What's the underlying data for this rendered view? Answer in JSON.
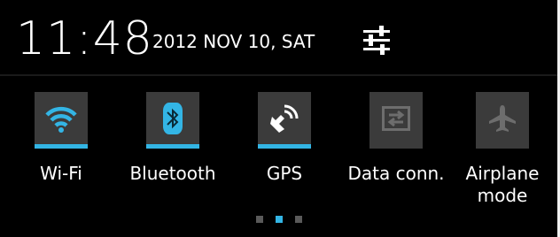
{
  "status": {
    "time": "11:48",
    "date": "2012 NOV 10, SAT"
  },
  "toggles": [
    {
      "label": "Wi-Fi",
      "icon": "wifi-icon",
      "enabled": true
    },
    {
      "label": "Bluetooth",
      "icon": "bluetooth-icon",
      "enabled": true
    },
    {
      "label": "GPS",
      "icon": "gps-icon",
      "enabled": true
    },
    {
      "label": "Data conn.",
      "icon": "data-connection-icon",
      "enabled": false
    },
    {
      "label": "Airplane mode",
      "icon": "airplane-icon",
      "enabled": false
    }
  ],
  "pager": {
    "pages": 3,
    "current": 2
  },
  "colors": {
    "accent": "#33b5e5",
    "tile": "#3b3b3b",
    "background": "#000000"
  }
}
